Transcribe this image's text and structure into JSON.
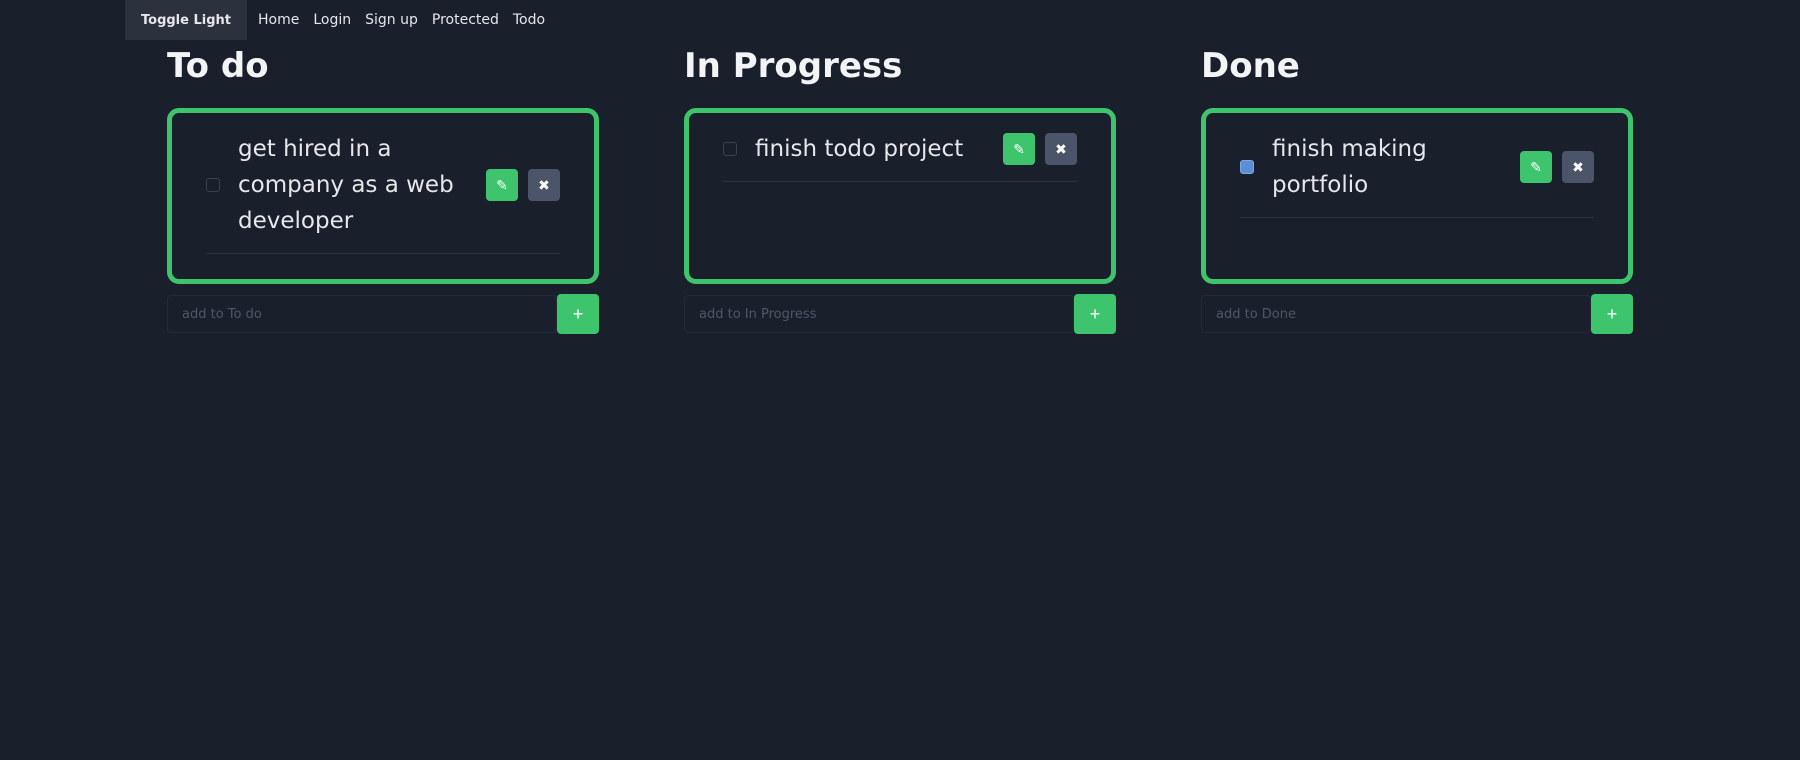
{
  "nav": {
    "toggle_label": "Toggle Light",
    "links": [
      "Home",
      "Login",
      "Sign up",
      "Protected",
      "Todo"
    ]
  },
  "columns": [
    {
      "title": "To do",
      "items": [
        {
          "text": "get hired in a company as a web developer",
          "checked": false
        }
      ],
      "placeholder": "add to To do",
      "add_label": "+"
    },
    {
      "title": "In Progress",
      "items": [
        {
          "text": "finish todo project",
          "checked": false
        }
      ],
      "placeholder": "add to In Progress",
      "add_label": "+"
    },
    {
      "title": "Done",
      "items": [
        {
          "text": "finish making portfolio",
          "checked": true
        }
      ],
      "placeholder": "add to Done",
      "add_label": "+"
    }
  ],
  "icons": {
    "edit": "edit-icon",
    "delete": "close-icon"
  },
  "colors": {
    "background": "#1a1f2c",
    "accent": "#3ec46d",
    "delete_button": "#4b5468",
    "checked": "#5a8fd6"
  }
}
